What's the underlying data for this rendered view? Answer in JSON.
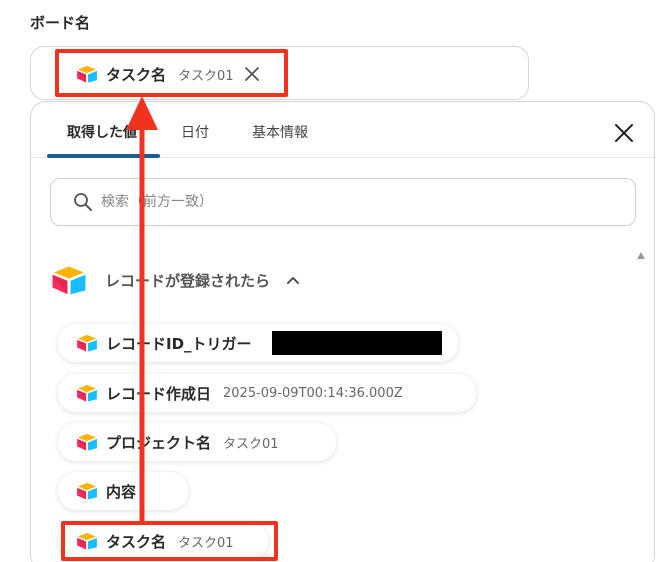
{
  "field": {
    "label": "ボード名",
    "selected": {
      "name": "タスク名",
      "value": "タスク01"
    }
  },
  "tabs": [
    {
      "label": "取得した値"
    },
    {
      "label": "日付"
    },
    {
      "label": "基本情報"
    }
  ],
  "search": {
    "placeholder": "検索（前方一致）"
  },
  "group": {
    "title": "レコードが登録されたら"
  },
  "items": [
    {
      "name": "レコードID_トリガー",
      "value": ""
    },
    {
      "name": "レコード作成日",
      "value": "2025-09-09T00:14:36.000Z"
    },
    {
      "name": "プロジェクト名",
      "value": "タスク01"
    },
    {
      "name": "内容",
      "value": ""
    },
    {
      "name": "タスク名",
      "value": "タスク01"
    }
  ],
  "colors": {
    "highlight": "#f0321e",
    "tab_underline": "#1d5e8c",
    "logo_yellow": "#fcb400",
    "logo_red": "#f82b60",
    "logo_blue": "#18bfff",
    "logo_navy": "#1a3a6b"
  },
  "icons": [
    "airtable-logo-icon",
    "close-icon",
    "search-icon",
    "chevron-up-icon",
    "scroll-up-icon"
  ]
}
